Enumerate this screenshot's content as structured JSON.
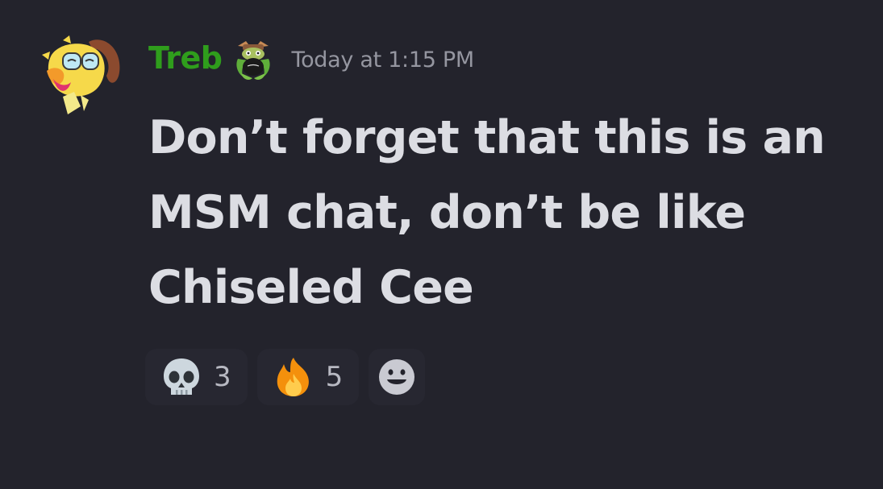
{
  "message": {
    "author": "Treb",
    "timestamp": "Today at 1:15 PM",
    "content_lines": [
      "Don’t forget that this is an",
      "MSM chat, don’t be like",
      "Chiseled Cee"
    ],
    "author_color": "#2f9d1c",
    "role_icon": "monster-role-icon",
    "avatar_icon": "yellow-cartoon-avatar"
  },
  "reactions": [
    {
      "emoji": "skull-icon",
      "count": "3"
    },
    {
      "emoji": "fire-icon",
      "count": "5"
    }
  ],
  "add_reaction": {
    "icon": "add-reaction-smiley-icon"
  },
  "colors": {
    "background": "#23232c",
    "text": "#dcdde3",
    "timestamp": "#9596a0",
    "reaction_background": "#272731"
  }
}
